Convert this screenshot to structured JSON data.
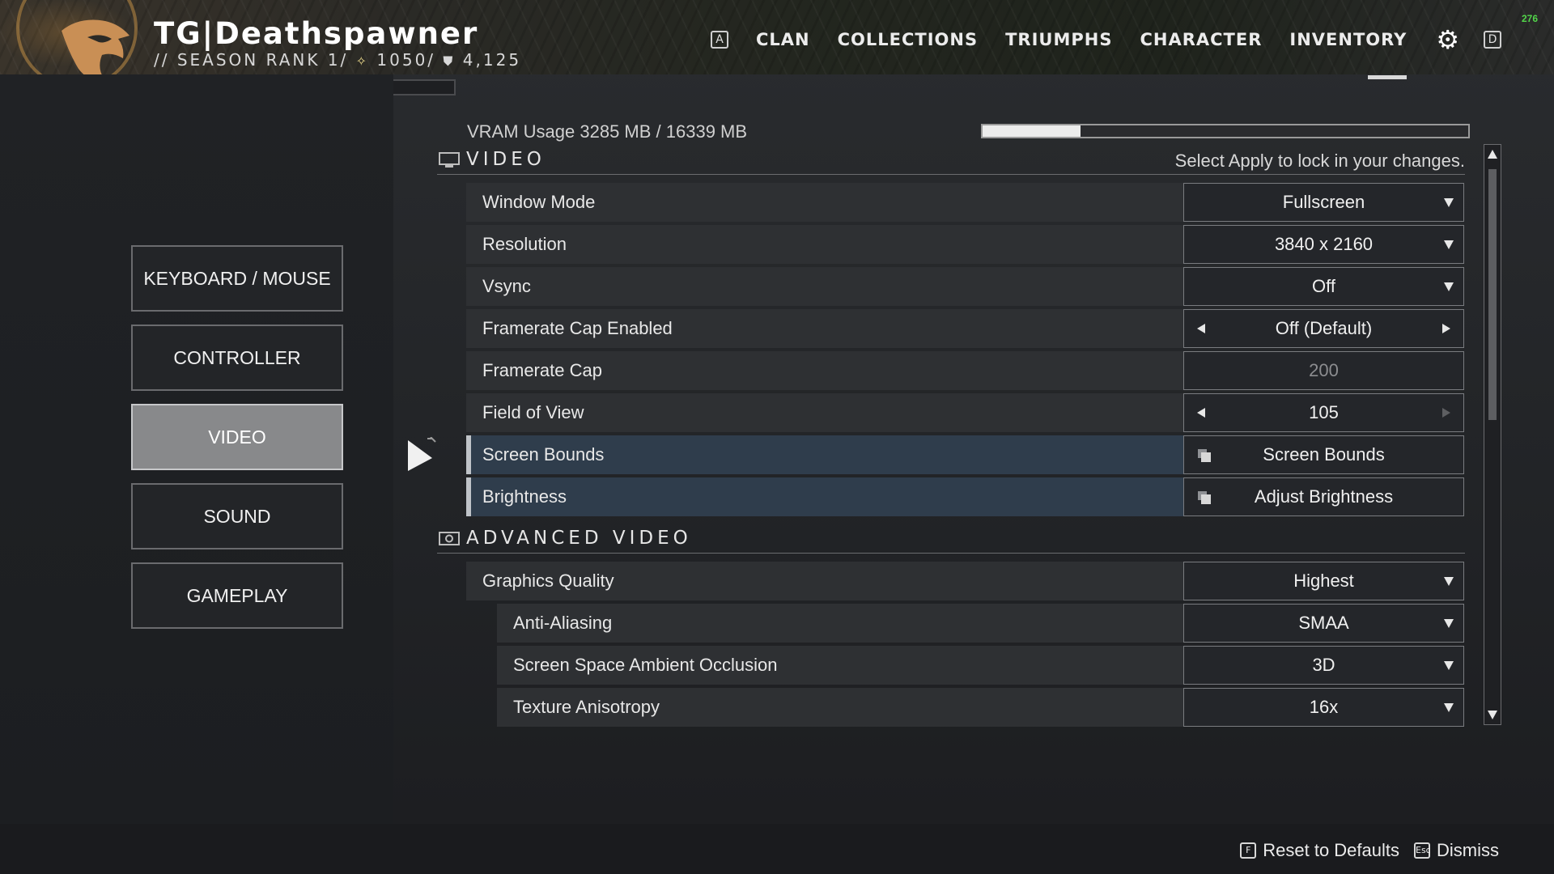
{
  "header": {
    "player_name": "TG|Deathspawner",
    "prefix": "//",
    "season_rank_label": "SEASON RANK 1/",
    "power_value": "1050/",
    "glimmer_value": "4,125",
    "nav_left_key": "A",
    "nav_right_key": "D",
    "nav": [
      {
        "label": "CLAN"
      },
      {
        "label": "COLLECTIONS"
      },
      {
        "label": "TRIUMPHS"
      },
      {
        "label": "CHARACTER"
      },
      {
        "label": "INVENTORY"
      }
    ],
    "settings_icon": "gear-icon",
    "fps_counter": "276"
  },
  "categories": [
    {
      "label": "KEYBOARD / MOUSE",
      "active": false
    },
    {
      "label": "CONTROLLER",
      "active": false
    },
    {
      "label": "VIDEO",
      "active": true
    },
    {
      "label": "SOUND",
      "active": false
    },
    {
      "label": "GAMEPLAY",
      "active": false
    }
  ],
  "vram": {
    "label": "VRAM Usage 3285 MB / 16339 MB",
    "used_mb": 3285,
    "total_mb": 16339
  },
  "video_section": {
    "title": "VIDEO",
    "hint": "Select Apply to lock in your changes.",
    "rows": [
      {
        "label": "Window Mode",
        "value": "Fullscreen",
        "control": "dropdown"
      },
      {
        "label": "Resolution",
        "value": "3840 x 2160",
        "control": "dropdown"
      },
      {
        "label": "Vsync",
        "value": "Off",
        "control": "dropdown"
      },
      {
        "label": "Framerate Cap Enabled",
        "value": "Off (Default)",
        "control": "stepper"
      },
      {
        "label": "Framerate Cap",
        "value": "200",
        "control": "disabled"
      },
      {
        "label": "Field of View",
        "value": "105",
        "control": "slider"
      },
      {
        "label": "Screen Bounds",
        "value": "Screen Bounds",
        "control": "popup"
      },
      {
        "label": "Brightness",
        "value": "Adjust Brightness",
        "control": "popup"
      }
    ]
  },
  "advanced_section": {
    "title": "ADVANCED VIDEO",
    "rows": [
      {
        "label": "Graphics Quality",
        "value": "Highest",
        "control": "dropdown"
      },
      {
        "label": "Anti-Aliasing",
        "value": "SMAA",
        "control": "dropdown"
      },
      {
        "label": "Screen Space Ambient Occlusion",
        "value": "3D",
        "control": "dropdown"
      },
      {
        "label": "Texture Anisotropy",
        "value": "16x",
        "control": "dropdown"
      }
    ]
  },
  "footer": {
    "reset_key": "F",
    "reset_label": "Reset to Defaults",
    "dismiss_key": "Esc",
    "dismiss_label": "Dismiss"
  },
  "colors": {
    "highlight_row": "#2f3d4c",
    "active_category": "#88898b",
    "fps_green": "#52d64a"
  }
}
